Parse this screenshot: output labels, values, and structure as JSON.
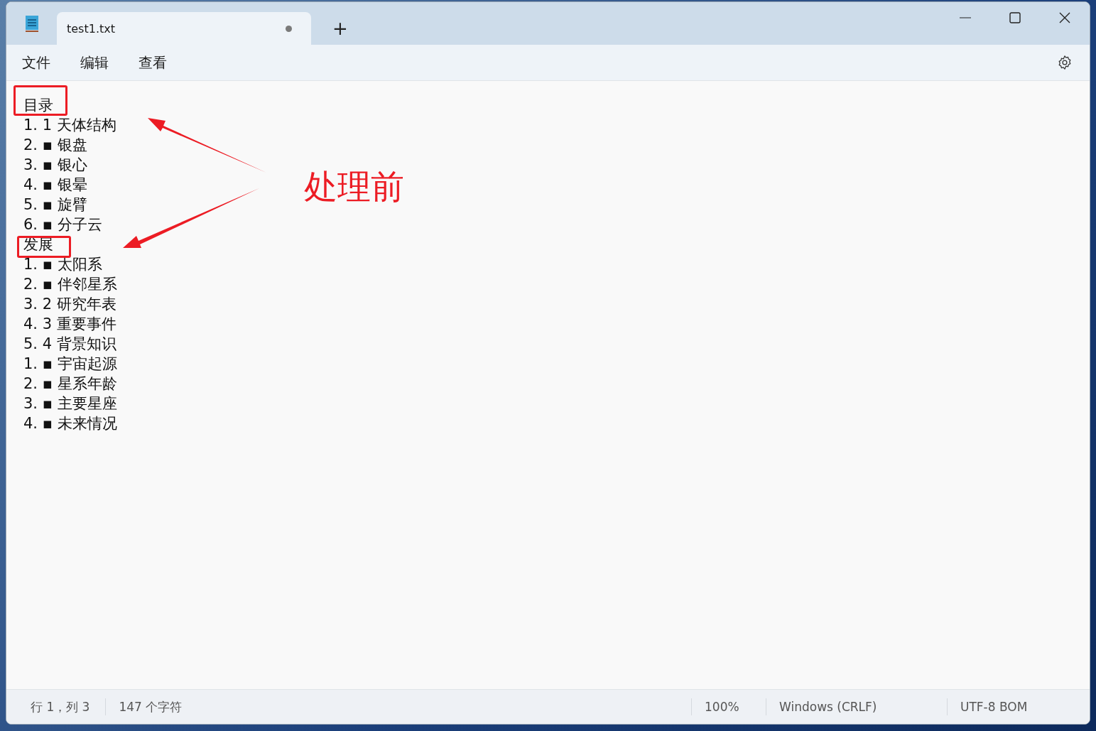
{
  "tab": {
    "title": "test1.txt",
    "unsaved": true,
    "selected": true
  },
  "new_tab": "+",
  "menu": [
    "文件",
    "编辑",
    "查看"
  ],
  "lines": [
    "目录",
    "1. 1 天体结构",
    "2. ▪ 银盘",
    "3. ▪ 银心",
    "4. ▪ 银晕",
    "5. ▪ 旋臂",
    "6. ▪ 分子云",
    "发展",
    "1. ▪ 太阳系",
    "2. ▪ 伴邻星系",
    "3. 2 研究年表",
    "4. 3 重要事件",
    "5. 4 背景知识",
    "1. ▪ 宇宙起源",
    "2. ▪ 星系年龄",
    "3. ▪ 主要星座",
    "4. ▪ 未来情况"
  ],
  "annotation": {
    "label": "处理前"
  },
  "status_bar": {
    "position": "行 1，列 3",
    "characters": "147 个字符",
    "zoom": "100%",
    "line_ending": "Windows (CRLF)",
    "encoding": "UTF-8 BOM"
  }
}
